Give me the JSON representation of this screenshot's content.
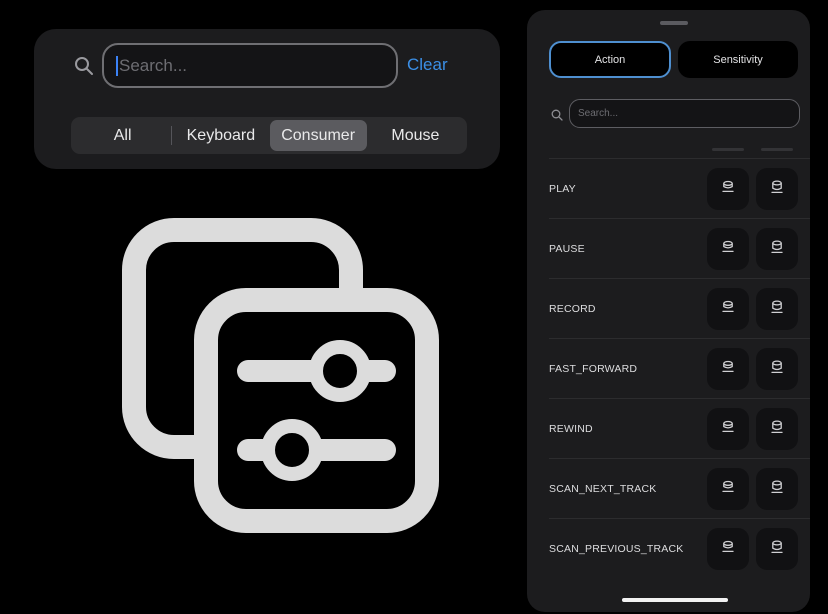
{
  "search_panel": {
    "search_icon": "magnifier-icon",
    "input": {
      "value": "",
      "placeholder": "Search..."
    },
    "clear_label": "Clear",
    "accent_color": "#3b8fe6",
    "segments": [
      {
        "label": "All",
        "selected": false
      },
      {
        "label": "Keyboard",
        "selected": false
      },
      {
        "label": "Consumer",
        "selected": true
      },
      {
        "label": "Mouse",
        "selected": false
      }
    ]
  },
  "app_icon": {
    "name": "sliders-copy-icon",
    "color": "#dcdcdc"
  },
  "phone": {
    "tabs": [
      {
        "label": "Action",
        "selected": true
      },
      {
        "label": "Sensitivity",
        "selected": false
      }
    ],
    "search": {
      "placeholder": "Search...",
      "value": ""
    },
    "rows": [
      {
        "label": "PLAY"
      },
      {
        "label": "PAUSE"
      },
      {
        "label": "RECORD"
      },
      {
        "label": "FAST_FORWARD"
      },
      {
        "label": "REWIND"
      },
      {
        "label": "SCAN_NEXT_TRACK"
      },
      {
        "label": "SCAN_PREVIOUS_TRACK"
      }
    ],
    "row_buttons": [
      {
        "icon": "button-press-icon"
      },
      {
        "icon": "button-release-icon"
      }
    ]
  }
}
